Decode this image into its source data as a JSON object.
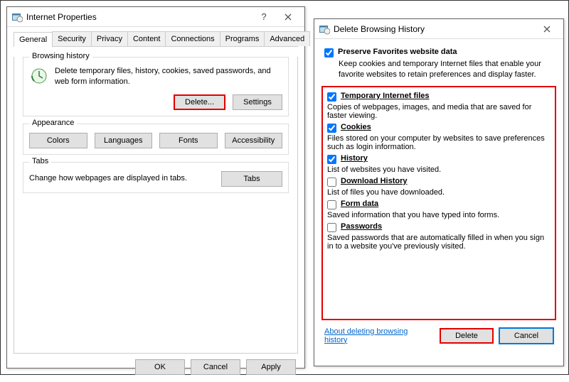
{
  "ip": {
    "title": "Internet Properties",
    "tabs": [
      "General",
      "Security",
      "Privacy",
      "Content",
      "Connections",
      "Programs",
      "Advanced"
    ],
    "bh": {
      "title": "Browsing history",
      "desc": "Delete temporary files, history, cookies, saved passwords, and web form information.",
      "delete": "Delete...",
      "settings": "Settings"
    },
    "ap": {
      "title": "Appearance",
      "colors": "Colors",
      "languages": "Languages",
      "fonts": "Fonts",
      "accessibility": "Accessibility"
    },
    "tabsgrp": {
      "title": "Tabs",
      "desc": "Change how webpages are displayed in tabs.",
      "tabs": "Tabs"
    },
    "ok": "OK",
    "cancel": "Cancel",
    "apply": "Apply"
  },
  "dbh": {
    "title": "Delete Browsing History",
    "preserve": {
      "label": "Preserve Favorites website data",
      "desc": "Keep cookies and temporary Internet files that enable your favorite websites to retain preferences and display faster."
    },
    "items": [
      {
        "label": "Temporary Internet files",
        "desc": "Copies of webpages, images, and media that are saved for faster viewing.",
        "checked": true
      },
      {
        "label": "Cookies",
        "desc": "Files stored on your computer by websites to save preferences such as login information.",
        "checked": true
      },
      {
        "label": "History",
        "desc": "List of websites you have visited.",
        "checked": true
      },
      {
        "label": "Download History",
        "desc": "List of files you have downloaded.",
        "checked": false
      },
      {
        "label": "Form data",
        "desc": "Saved information that you have typed into forms.",
        "checked": false
      },
      {
        "label": "Passwords",
        "desc": "Saved passwords that are automatically filled in when you sign in to a website you've previously visited.",
        "checked": false
      }
    ],
    "link": "About deleting browsing history",
    "delete": "Delete",
    "cancel": "Cancel"
  }
}
